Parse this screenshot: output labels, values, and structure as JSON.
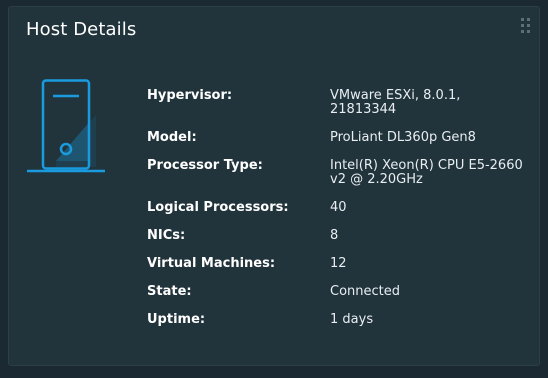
{
  "card": {
    "title": "Host Details",
    "icons": {
      "drag": "drag-handle-icon",
      "host": "server-tower-icon"
    },
    "colors": {
      "background": "#1b2a32",
      "card": "#21333b",
      "accent": "#1a9be0",
      "label": "#ffffff",
      "value": "#e8eef1"
    }
  },
  "details": [
    {
      "label": "Hypervisor:",
      "value": "VMware ESXi, 8.0.1, 21813344"
    },
    {
      "label": "Model:",
      "value": "ProLiant DL360p Gen8"
    },
    {
      "label": "Processor Type:",
      "value": "Intel(R) Xeon(R) CPU E5-2660\nv2 @ 2.20GHz"
    },
    {
      "label": "Logical Processors:",
      "value": "40"
    },
    {
      "label": "NICs:",
      "value": "8"
    },
    {
      "label": "Virtual Machines:",
      "value": "12"
    },
    {
      "label": "State:",
      "value": "Connected"
    },
    {
      "label": "Uptime:",
      "value": "1 days"
    }
  ]
}
